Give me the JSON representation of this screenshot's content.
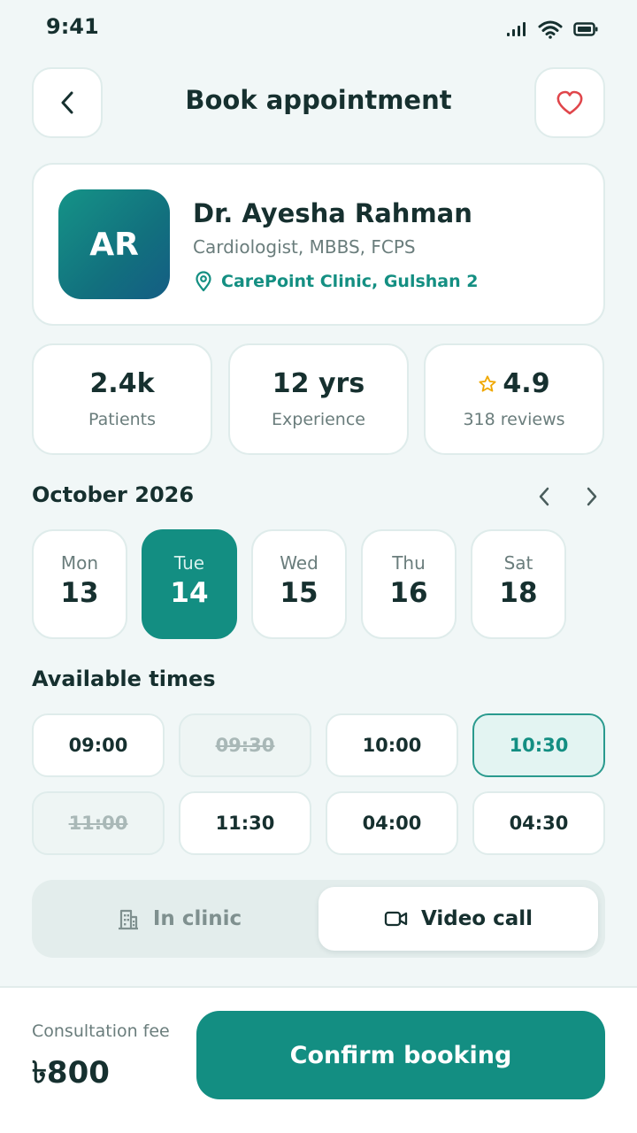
{
  "status_bar": {
    "time": "9:41"
  },
  "header": {
    "title": "Book appointment"
  },
  "doctor": {
    "initials": "AR",
    "name": "Dr. Ayesha Rahman",
    "specialty": "Cardiologist, MBBS, FCPS",
    "location": "CarePoint Clinic, Gulshan 2"
  },
  "stats": [
    {
      "value": "2.4k",
      "label": "Patients"
    },
    {
      "value": "12 yrs",
      "label": "Experience"
    },
    {
      "value": "4.9",
      "label": "318 reviews"
    }
  ],
  "calendar": {
    "month": "October 2026",
    "days": [
      {
        "name": "Mon",
        "num": "13"
      },
      {
        "name": "Tue",
        "num": "14"
      },
      {
        "name": "Wed",
        "num": "15"
      },
      {
        "name": "Thu",
        "num": "16"
      },
      {
        "name": "Sat",
        "num": "18"
      }
    ],
    "selected_index": 1
  },
  "times": {
    "label": "Available times",
    "slots": [
      {
        "time": "09:00",
        "state": "available"
      },
      {
        "time": "09:30",
        "state": "unavailable"
      },
      {
        "time": "10:00",
        "state": "available"
      },
      {
        "time": "10:30",
        "state": "selected"
      },
      {
        "time": "11:00",
        "state": "unavailable"
      },
      {
        "time": "11:30",
        "state": "available"
      },
      {
        "time": "04:00",
        "state": "available"
      },
      {
        "time": "04:30",
        "state": "available"
      }
    ]
  },
  "mode": {
    "options": [
      {
        "label": "In clinic",
        "icon": "building-icon"
      },
      {
        "label": "Video call",
        "icon": "video-camera-icon"
      }
    ],
    "selected": "Video call"
  },
  "footer": {
    "fee_label": "Consultation fee",
    "fee_amount": "৳800",
    "confirm_label": "Confirm booking"
  },
  "colors": {
    "accent": "#138e82",
    "background": "#f1f7f7",
    "heart": "#e0464b",
    "star": "#f0a800"
  }
}
